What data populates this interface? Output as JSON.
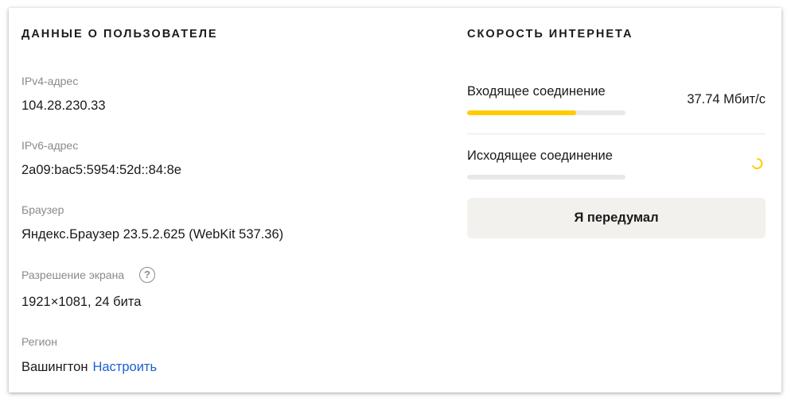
{
  "user_info": {
    "title": "ДАННЫЕ О ПОЛЬЗОВАТЕЛЕ",
    "ipv4": {
      "label": "IPv4-адрес",
      "value": "104.28.230.33"
    },
    "ipv6": {
      "label": "IPv6-адрес",
      "value": "2a09:bac5:5954:52d::84:8e"
    },
    "browser": {
      "label": "Браузер",
      "value": "Яндекс.Браузер 23.5.2.625 (WebKit 537.36)"
    },
    "screen": {
      "label": "Разрешение экрана",
      "help": "?",
      "value": "1921×1081, 24 бита"
    },
    "region": {
      "label": "Регион",
      "value": "Вашингтон",
      "link": "Настроить"
    }
  },
  "speed": {
    "title": "СКОРОСТЬ ИНТЕРНЕТА",
    "download": {
      "label": "Входящее соединение",
      "value": "37.74 Мбит/с",
      "progress": 0.69
    },
    "upload": {
      "label": "Исходящее соединение",
      "progress": 0.0,
      "state": "loading"
    },
    "cancel_label": "Я передумал"
  },
  "colors": {
    "accent": "#ffcc00",
    "link": "#1a5fcf",
    "muted_text": "#8a8a8a",
    "button_bg": "#f2f1ee",
    "track": "#e8e8ea"
  },
  "icons": {
    "help": "question-circle-icon",
    "spinner": "loading-spinner-icon"
  }
}
